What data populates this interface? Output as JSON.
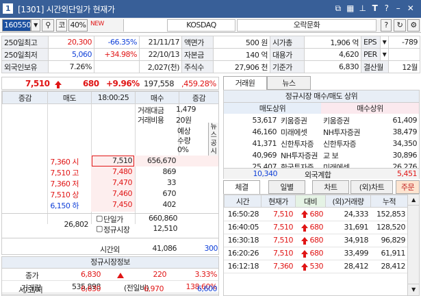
{
  "window": {
    "num": "1",
    "title": "[1301] 시간외단일가 현재가"
  },
  "toolbar": {
    "code": "160550",
    "market_short": "코",
    "margin": "40%",
    "new_label": "NEW",
    "market": "KOSDAQ",
    "sector": "오락문화",
    "help": "?"
  },
  "info": {
    "rows": [
      {
        "l1": "250일최고",
        "v1": "20,300",
        "c1": "-66.35%",
        "d1": "21/11/17",
        "l2": "액면가",
        "v2": "500 원",
        "l3": "시가총",
        "v3": "1,906 억",
        "l4": "EPS",
        "v4": "-789"
      },
      {
        "l1": "250일최저",
        "v1": "5,060",
        "c1": "+34.98%",
        "d1": "22/10/13",
        "l2": "자본금",
        "v2": "140 억",
        "l3": "대용가",
        "v3": "4,620",
        "l4": "PER",
        "v4": ""
      },
      {
        "l1": "외국인보유",
        "v1": "7.26%",
        "c1": "",
        "d1": "2,027(천)",
        "l2": "주식수",
        "v2": "27,906 천",
        "l3": "기준가",
        "v3": "6,830",
        "l4": "결산월",
        "v4": "12월"
      }
    ]
  },
  "quote": {
    "price": "7,510",
    "change": "680",
    "rate": "+9.96%",
    "volume": "197,558",
    "vol_rate": ",459.28%"
  },
  "orderbook": {
    "headers": [
      "증감",
      "매도",
      "18:00:25",
      "매수",
      "증감"
    ],
    "amount_label": "거래대금",
    "amount": "1,479",
    "cost_label": "거래비용",
    "cost": "20원",
    "expected_label": "예상",
    "qty_label": "수량",
    "expected_pct": "0%",
    "news_label": "뉴스공시",
    "asks": [
      {
        "label": "7,360 시",
        "price": "7,510",
        "qty": "656,670"
      },
      {
        "label": "7,510 고",
        "price": "7,480",
        "qty": "869"
      },
      {
        "label": "7,360 저",
        "price": "7,470",
        "qty": "33"
      },
      {
        "label": "7,510 상",
        "price": "7,460",
        "qty": "670"
      },
      {
        "label": "6,150 하",
        "price": "7,450",
        "qty": "402"
      }
    ],
    "sum_sell": "26,802",
    "summary": [
      {
        "label": "단일가",
        "value": "660,860"
      },
      {
        "label": "정규시장",
        "value": "12,510"
      },
      {
        "label": "시간외",
        "value": "41,086",
        "extra": "300"
      }
    ]
  },
  "regular": {
    "title": "정규시장정보",
    "rows": [
      {
        "label": "종가",
        "v1": "6,830",
        "mid": "220",
        "v2": "3.33%"
      },
      {
        "label": "거래량",
        "v1": "535,898",
        "mid": "(전일비)",
        "v2": "138.60%"
      },
      {
        "label": "시/고/저",
        "v1": "6,630",
        "mid": "6,970",
        "v2": "6,600"
      }
    ]
  },
  "broker": {
    "tabs": [
      "거래원",
      "뉴스"
    ],
    "title": "정규시장 매수/매도 상위",
    "sell_hdr": "매도상위",
    "buy_hdr": "매수상위",
    "rows": [
      {
        "sq": "53,617",
        "sn": "키움증권",
        "bn": "키움증권",
        "bq": "61,409"
      },
      {
        "sq": "46,160",
        "sn": "미래에셋",
        "bn": "NH투자증권",
        "bq": "38,479"
      },
      {
        "sq": "41,371",
        "sn": "신한투자증",
        "bn": "신한투자증",
        "bq": "34,350"
      },
      {
        "sq": "40,969",
        "sn": "NH투자증권",
        "bn": "교  보",
        "bq": "30,896"
      },
      {
        "sq": "25,407",
        "sn": "한국투자증",
        "bn": "미래에셋",
        "bq": "26,276"
      }
    ],
    "foreign_sell": "10,340",
    "foreign_label": "외국계합",
    "foreign_buy": "5,451"
  },
  "ticks": {
    "tabs": [
      "체결",
      "일별",
      "차트",
      "(외)차트",
      "주문"
    ],
    "headers": [
      "시간",
      "현재가",
      "대비",
      "(외)거래량",
      "누적"
    ],
    "rows": [
      {
        "t": "16:50:28",
        "p": "7,510",
        "d": "680",
        "v": "24,333",
        "a": "152,853"
      },
      {
        "t": "16:40:05",
        "p": "7,510",
        "d": "680",
        "v": "31,691",
        "a": "128,520"
      },
      {
        "t": "16:30:18",
        "p": "7,510",
        "d": "680",
        "v": "34,918",
        "a": "96,829"
      },
      {
        "t": "16:20:26",
        "p": "7,510",
        "d": "680",
        "v": "33,499",
        "a": "61,911"
      },
      {
        "t": "16:12:18",
        "p": "7,360",
        "d": "530",
        "v": "28,412",
        "a": "28,412"
      }
    ]
  }
}
